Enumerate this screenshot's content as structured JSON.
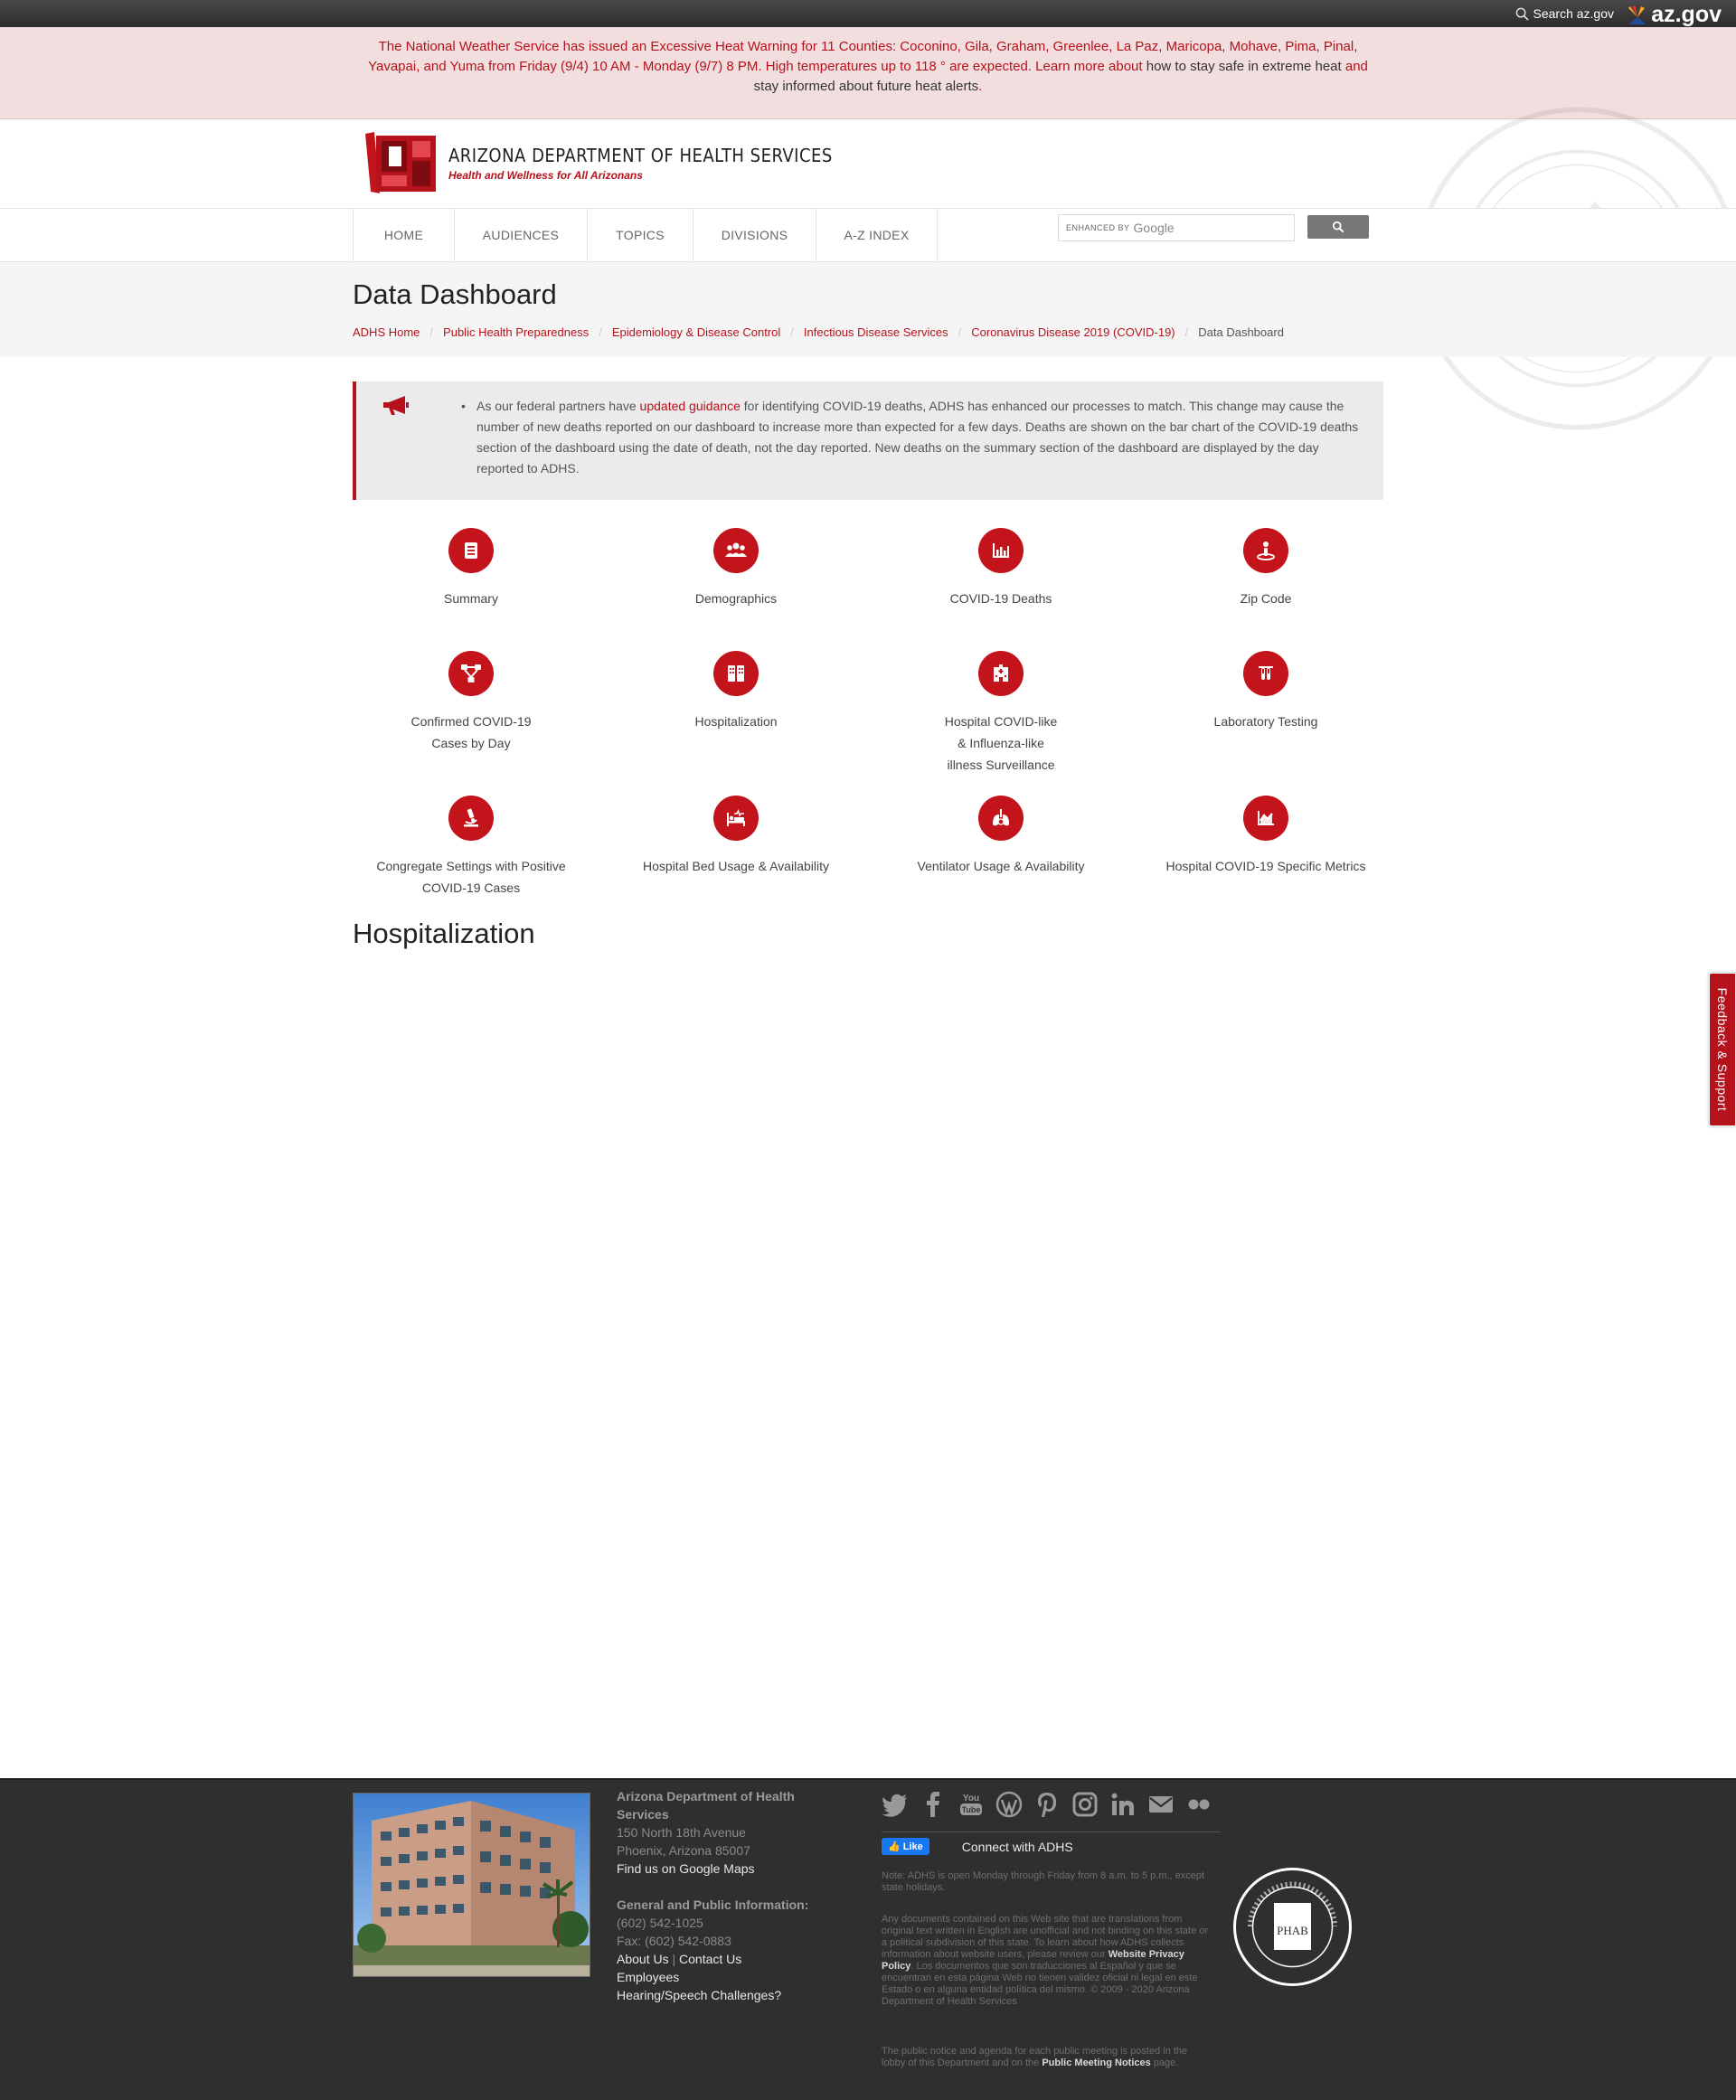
{
  "topbar": {
    "search_label": "Search az.gov",
    "brand": "az.gov"
  },
  "alert": {
    "text_part1": "The National Weather Service has issued an Excessive Heat Warning for 11 Counties: Coconino, Gila, Graham, Greenlee, La Paz, Maricopa, Mohave, Pima, Pinal, Yavapai, and Yuma from Friday (9/4) 10 AM - Monday (9/7) 8 PM. High temperatures up to 118 ° are expected. Learn more about ",
    "link1": "how to stay safe in extreme heat",
    "and": " and ",
    "link2": "stay informed about future heat alerts",
    "end": "."
  },
  "header": {
    "title": "ARIZONA DEPARTMENT OF HEALTH SERVICES",
    "tagline": "Health and Wellness for All Arizonans"
  },
  "nav": {
    "items": [
      {
        "label": "HOME"
      },
      {
        "label": "AUDIENCES"
      },
      {
        "label": "TOPICS"
      },
      {
        "label": "DIVISIONS"
      },
      {
        "label": "A-Z INDEX"
      }
    ],
    "search_prefix": "ENHANCED BY",
    "search_brand": "Google"
  },
  "page": {
    "title": "Data Dashboard",
    "breadcrumbs": [
      "ADHS Home",
      "Public Health Preparedness",
      "Epidemiology & Disease Control",
      "Infectious Disease Services",
      "Coronavirus Disease 2019 (COVID-19)"
    ],
    "breadcrumb_current": "Data Dashboard"
  },
  "notice": {
    "pre": "As our federal partners have ",
    "link": "updated guidance",
    "post": " for identifying COVID-19 deaths, ADHS has enhanced our processes to match. This change may cause the number of new deaths reported on our dashboard to increase more than expected for a few days. Deaths are shown on the bar chart of the COVID-19 deaths section of the dashboard using the date of death, not the day reported. New deaths on the summary section of the dashboard are displayed by the day reported to ADHS."
  },
  "tiles": [
    {
      "label": "Summary",
      "icon": "book-icon"
    },
    {
      "label": "Demographics",
      "icon": "people-icon"
    },
    {
      "label": "COVID-19 Deaths",
      "icon": "bar-chart-icon"
    },
    {
      "label": "Zip Code",
      "icon": "map-pin-icon"
    },
    {
      "label": "Confirmed COVID-19\nCases by Day",
      "icon": "network-icon"
    },
    {
      "label": "Hospitalization",
      "icon": "building-icon"
    },
    {
      "label": "Hospital COVID-like\n& Influenza-like\nillness Surveillance",
      "icon": "hospital-icon"
    },
    {
      "label": "Laboratory Testing",
      "icon": "test-tubes-icon"
    },
    {
      "label": "Congregate Settings with Positive\nCOVID-19 Cases",
      "icon": "microscope-icon"
    },
    {
      "label": "Hospital Bed Usage & Availability",
      "icon": "hospital-bed-icon"
    },
    {
      "label": "Ventilator Usage & Availability",
      "icon": "lungs-icon"
    },
    {
      "label": "Hospital COVID-19 Specific Metrics",
      "icon": "line-chart-icon"
    }
  ],
  "section_heading": "Hospitalization",
  "feedback_label": "Feedback & Support",
  "footer": {
    "org": "Arizona Department of Health Services",
    "address1": "150 North 18th Avenue",
    "address2": "Phoenix, Arizona 85007",
    "maps": "Find us on Google Maps",
    "info_heading": "General and Public Information:",
    "phone": "(602) 542-1025",
    "fax": "Fax: (602) 542-0883",
    "about": "About Us",
    "contact": "Contact Us",
    "employees": "Employees",
    "hearing": "Hearing/Speech Challenges?",
    "like": "Like",
    "connect": "Connect with ADHS",
    "note": "Note: ADHS is open Monday through Friday from 8 a.m. to 5 p.m., except state holidays.",
    "disclaimer_pre": "Any documents contained on this Web site that are translations from original text written in English are unofficial and not binding on this state or a political subdivision of this state. To learn about how ADHS collects information about website users, please review our ",
    "privacy": "Website Privacy Policy",
    "disclaimer_post": ". Los documentos que son traducciones al Español y que se encuentran en esta página Web no tienen validez oficial ni legal en este Estado o en alguna entidad política del mismo. © 2009 - 2020 Arizona Department of Health Services",
    "meeting_pre": "The public notice and agenda for each public meeting is posted in the lobby of this Department and on the ",
    "meeting_link": "Public Meeting Notices",
    "meeting_post": " page.",
    "phab_text": "PHAB"
  },
  "colors": {
    "brand_red": "#b5121b",
    "alert_bg": "#f2dede",
    "footer_bg": "#2f2f2f"
  }
}
